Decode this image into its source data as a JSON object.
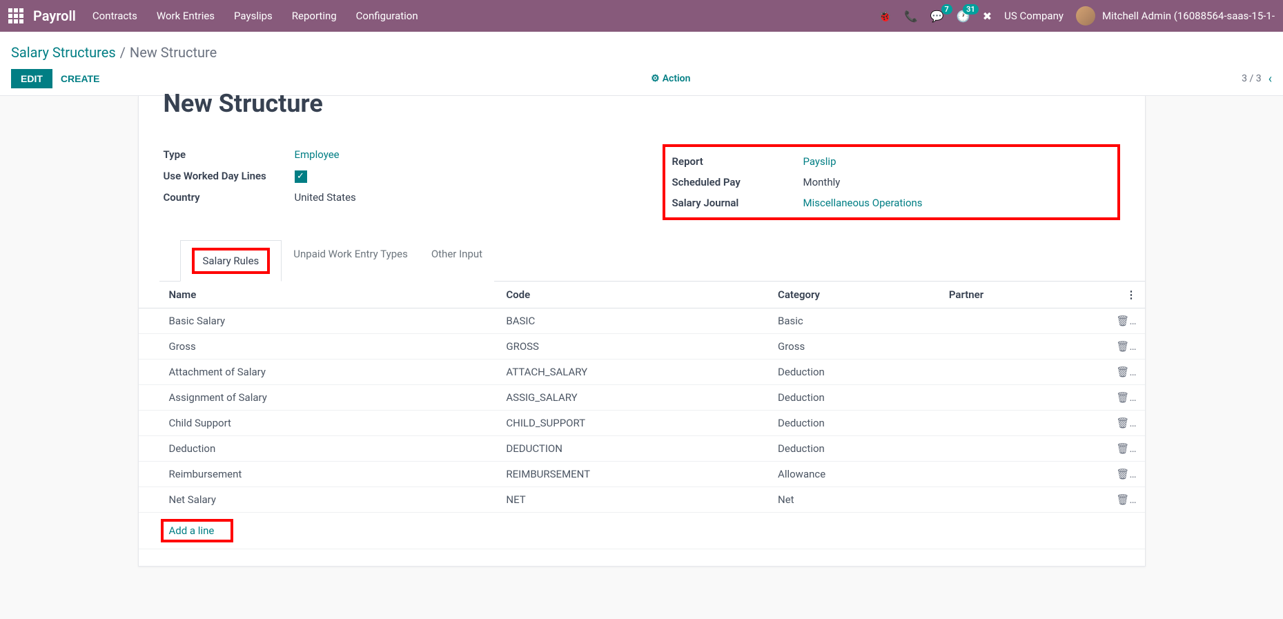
{
  "nav": {
    "brand": "Payroll",
    "items": [
      "Contracts",
      "Work Entries",
      "Payslips",
      "Reporting",
      "Configuration"
    ],
    "conversations_badge": "7",
    "activities_badge": "31",
    "company": "US Company",
    "user": "Mitchell Admin (16088564-saas-15-1-"
  },
  "breadcrumb": {
    "parent": "Salary Structures",
    "sep": "/",
    "current": "New Structure"
  },
  "buttons": {
    "edit": "EDIT",
    "create": "CREATE",
    "action": "Action"
  },
  "pager": {
    "text": "3 / 3"
  },
  "form": {
    "title": "New Structure",
    "left": {
      "type_label": "Type",
      "type_value": "Employee",
      "worked_day_label": "Use Worked Day Lines",
      "worked_day_checked": true,
      "country_label": "Country",
      "country_value": "United States"
    },
    "right": {
      "report_label": "Report",
      "report_value": "Payslip",
      "scheduled_label": "Scheduled Pay",
      "scheduled_value": "Monthly",
      "journal_label": "Salary Journal",
      "journal_value": "Miscellaneous Operations"
    }
  },
  "tabs": {
    "salary_rules": "Salary Rules",
    "unpaid": "Unpaid Work Entry Types",
    "other_input": "Other Input"
  },
  "table": {
    "headers": {
      "name": "Name",
      "code": "Code",
      "category": "Category",
      "partner": "Partner"
    },
    "rows": [
      {
        "name": "Basic Salary",
        "code": "BASIC",
        "category": "Basic",
        "partner": ""
      },
      {
        "name": "Gross",
        "code": "GROSS",
        "category": "Gross",
        "partner": ""
      },
      {
        "name": "Attachment of Salary",
        "code": "ATTACH_SALARY",
        "category": "Deduction",
        "partner": ""
      },
      {
        "name": "Assignment of Salary",
        "code": "ASSIG_SALARY",
        "category": "Deduction",
        "partner": ""
      },
      {
        "name": "Child Support",
        "code": "CHILD_SUPPORT",
        "category": "Deduction",
        "partner": ""
      },
      {
        "name": "Deduction",
        "code": "DEDUCTION",
        "category": "Deduction",
        "partner": ""
      },
      {
        "name": "Reimbursement",
        "code": "REIMBURSEMENT",
        "category": "Allowance",
        "partner": ""
      },
      {
        "name": "Net Salary",
        "code": "NET",
        "category": "Net",
        "partner": ""
      }
    ],
    "add_line": "Add a line"
  }
}
